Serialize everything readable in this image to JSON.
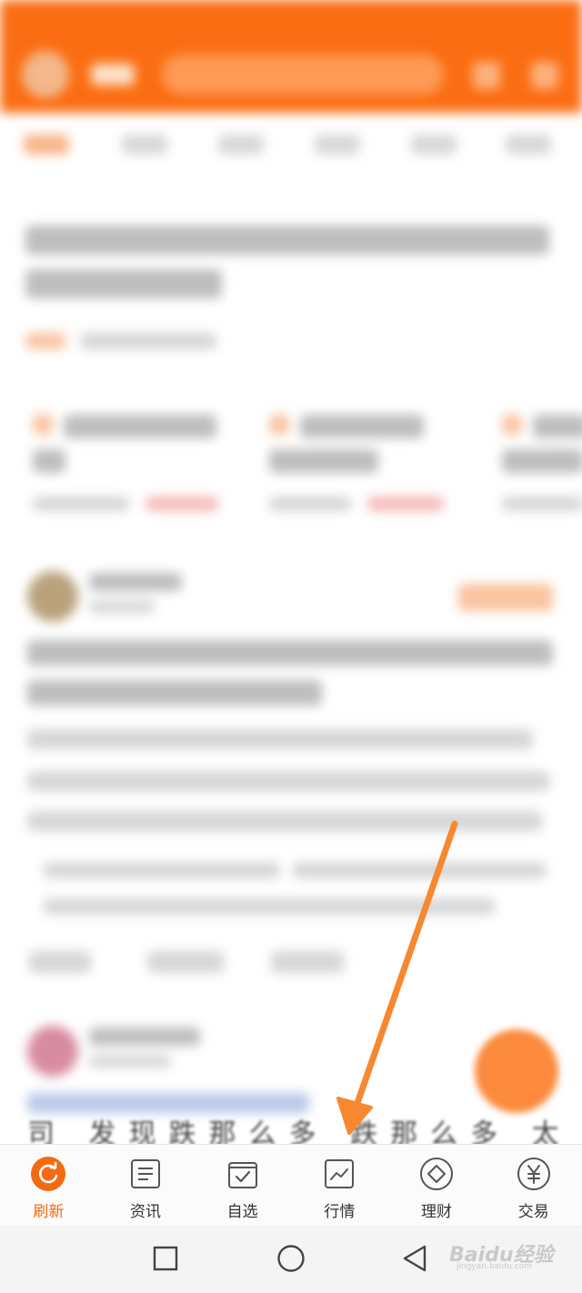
{
  "peek_text": "司  发现跌那么多  跌那么多  太奇怪了",
  "bottom_nav": {
    "items": [
      {
        "label": "刷新",
        "icon": "refresh-icon",
        "active": true
      },
      {
        "label": "资讯",
        "icon": "news-icon",
        "active": false
      },
      {
        "label": "自选",
        "icon": "watchlist-icon",
        "active": false
      },
      {
        "label": "行情",
        "icon": "market-chart-icon",
        "active": false
      },
      {
        "label": "理财",
        "icon": "wealth-diamond-icon",
        "active": false
      },
      {
        "label": "交易",
        "icon": "trade-yuan-icon",
        "active": false
      }
    ]
  },
  "system_nav": {
    "recent": "square-icon",
    "home": "circle-icon",
    "back": "triangle-back-icon"
  },
  "colors": {
    "accent": "#fb6d12",
    "active_label": "#f36a12",
    "annotation_arrow": "#f7882f"
  },
  "watermark": {
    "main": "Baidu经验",
    "sub": "jingyan.baidu.com"
  }
}
